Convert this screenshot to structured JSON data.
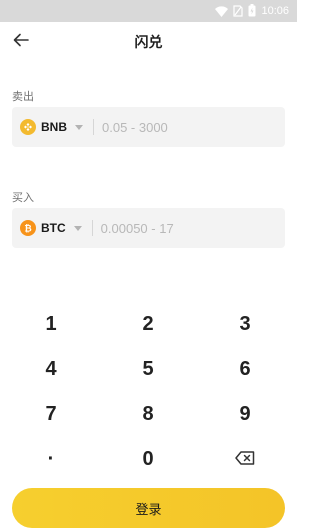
{
  "status_bar": {
    "time": "10:06"
  },
  "header": {
    "title": "闪兑"
  },
  "sell": {
    "label": "卖出",
    "coin": "BNB",
    "placeholder": "0.05 - 3000"
  },
  "buy": {
    "label": "买入",
    "coin": "BTC",
    "placeholder": "0.00050 - 17"
  },
  "keypad": {
    "keys": [
      "1",
      "2",
      "3",
      "4",
      "5",
      "6",
      "7",
      "8",
      "9",
      "·",
      "0"
    ]
  },
  "login_button": {
    "label": "登录"
  },
  "colors": {
    "accent": "#F5C92C",
    "bnb": "#F3BA2F",
    "btc": "#F7931A"
  }
}
